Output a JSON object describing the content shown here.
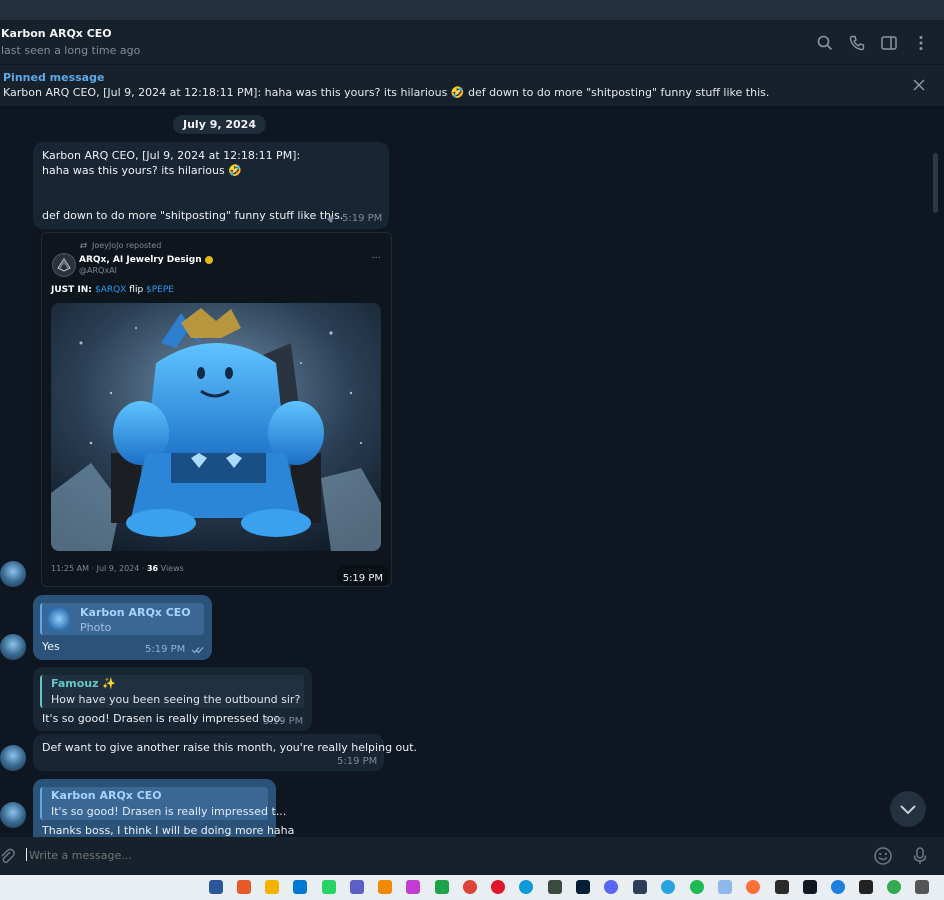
{
  "header": {
    "title": "Karbon ARQx CEO",
    "status": "last seen a long time ago",
    "icons": [
      "search-icon",
      "phone-icon",
      "sidebar-toggle-icon",
      "more-vertical-icon"
    ]
  },
  "pinned": {
    "title": "Pinned message",
    "text": "Karbon ARQ CEO, [Jul 9, 2024 at 12:18:11 PM]: haha was this yours? its hilarious 🤣  def down to do more \"shitposting\" funny stuff like this."
  },
  "chat": {
    "date_separator": "July 9, 2024",
    "messages": [
      {
        "lines": [
          "Karbon ARQ CEO, [Jul 9, 2024 at 12:18:11 PM]:",
          "haha was this yours? its hilarious 🤣",
          "def down to do more \"shitposting\" funny stuff like this."
        ],
        "time": "5:19 PM"
      },
      {
        "tweet": {
          "repost": "JoeyJoJo reposted",
          "name": "ARQx, AI Jewelry Design",
          "handle": "@ARQxAI",
          "more": "···",
          "body_prefix": "JUST IN: ",
          "cashtag1": "$ARQX",
          "body_mid": " flip ",
          "cashtag2": "$PEPE",
          "meta_time": "11:25 AM · Jul 9, 2024 · ",
          "meta_views": "36",
          "meta_views_label": " Views"
        },
        "time": "5:19 PM"
      },
      {
        "reply_name": "Karbon ARQx CEO",
        "reply_text": "Photo",
        "text": "Yes",
        "time": "5:19 PM"
      },
      {
        "reply_name": "Famouz ✨",
        "reply_text": "How have you been seeing the outbound sir?",
        "text": "It's so good! Drasen is really impressed too.",
        "time": "5:19 PM"
      },
      {
        "text": "Def want to give another raise this month, you're really helping out.",
        "time": "5:19 PM"
      },
      {
        "reply_name": "Karbon ARQx CEO",
        "reply_text": "It's so good! Drasen is really impressed t...",
        "text": "Thanks boss, I think I will be doing more haha"
      }
    ]
  },
  "composer": {
    "placeholder": "Write a message..."
  },
  "colors": {
    "background": "#0e1621",
    "panel": "#17212b",
    "incoming": "#182533",
    "outgoing": "#2b5278",
    "accent": "#5ea8ea"
  }
}
